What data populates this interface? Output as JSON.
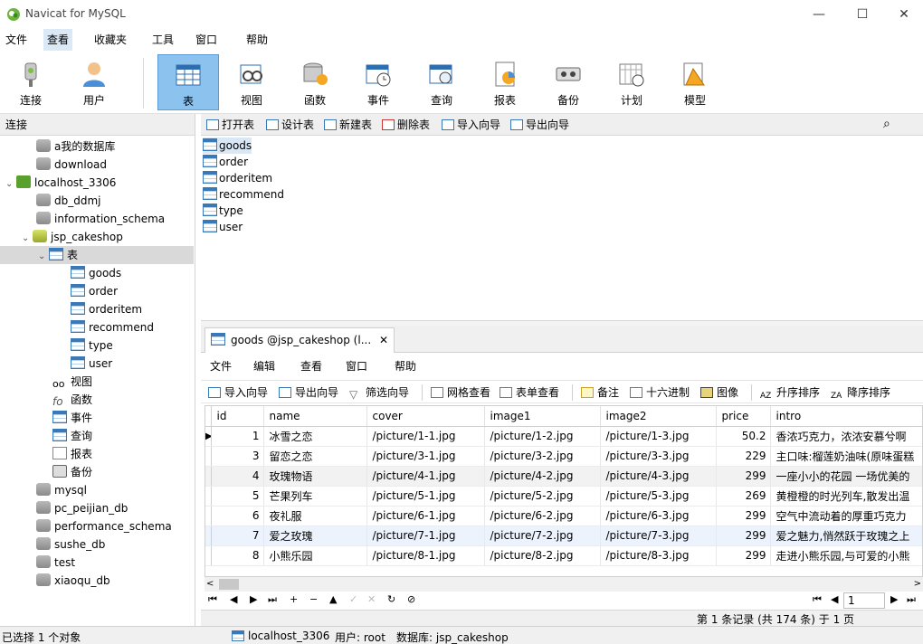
{
  "window": {
    "title": "Navicat for MySQL",
    "controls": {
      "minimize": "—",
      "maximize": "☐",
      "close": "✕"
    }
  },
  "menubar": [
    "文件",
    "查看",
    "收藏夹",
    "工具",
    "窗口",
    "帮助"
  ],
  "toolbar": [
    {
      "label": "连接",
      "icon": "plug-icon"
    },
    {
      "label": "用户",
      "icon": "user-icon"
    },
    {
      "label": "表",
      "icon": "table-icon",
      "active": true
    },
    {
      "label": "视图",
      "icon": "view-icon"
    },
    {
      "label": "函数",
      "icon": "function-icon"
    },
    {
      "label": "事件",
      "icon": "event-icon"
    },
    {
      "label": "查询",
      "icon": "query-icon"
    },
    {
      "label": "报表",
      "icon": "report-icon"
    },
    {
      "label": "备份",
      "icon": "backup-icon"
    },
    {
      "label": "计划",
      "icon": "schedule-icon"
    },
    {
      "label": "模型",
      "icon": "model-icon"
    }
  ],
  "left_panel": {
    "header": "连接",
    "tree": [
      {
        "label": "a我的数据库",
        "type": "db"
      },
      {
        "label": "download",
        "type": "db"
      },
      {
        "label": "localhost_3306",
        "type": "server",
        "expanded": true
      },
      {
        "label": "db_ddmj",
        "type": "db"
      },
      {
        "label": "information_schema",
        "type": "db"
      },
      {
        "label": "jsp_cakeshop",
        "type": "db-open",
        "expanded": true
      },
      {
        "label": "表",
        "type": "folder",
        "expanded": true,
        "selected": true
      },
      {
        "label": "goods",
        "type": "table"
      },
      {
        "label": "order",
        "type": "table"
      },
      {
        "label": "orderitem",
        "type": "table"
      },
      {
        "label": "recommend",
        "type": "table"
      },
      {
        "label": "type",
        "type": "table"
      },
      {
        "label": "user",
        "type": "table"
      },
      {
        "label": "视图",
        "type": "view"
      },
      {
        "label": "函数",
        "type": "function"
      },
      {
        "label": "事件",
        "type": "event"
      },
      {
        "label": "查询",
        "type": "query"
      },
      {
        "label": "报表",
        "type": "report"
      },
      {
        "label": "备份",
        "type": "backup"
      },
      {
        "label": "mysql",
        "type": "db"
      },
      {
        "label": "pc_peijian_db",
        "type": "db"
      },
      {
        "label": "performance_schema",
        "type": "db"
      },
      {
        "label": "sushe_db",
        "type": "db"
      },
      {
        "label": "test",
        "type": "db"
      },
      {
        "label": "xiaoqu_db",
        "type": "db"
      }
    ]
  },
  "object_toolbar": [
    "打开表",
    "设计表",
    "新建表",
    "删除表",
    "导入向导",
    "导出向导"
  ],
  "object_list": [
    "goods",
    "order",
    "orderitem",
    "recommend",
    "type",
    "user"
  ],
  "query_tab": {
    "title": "goods @jsp_cakeshop (l...",
    "close": "✕",
    "menu": [
      "文件",
      "编辑",
      "查看",
      "窗口",
      "帮助"
    ],
    "tools": [
      "导入向导",
      "导出向导",
      "筛选向导",
      "网格查看",
      "表单查看",
      "备注",
      "十六进制",
      "图像",
      "升序排序",
      "降序排序"
    ]
  },
  "grid": {
    "columns": [
      "id",
      "name",
      "cover",
      "image1",
      "image2",
      "price",
      "intro"
    ],
    "rows": [
      [
        "1",
        "冰雪之恋",
        "/picture/1-1.jpg",
        "/picture/1-2.jpg",
        "/picture/1-3.jpg",
        "50.2",
        "香浓巧克力，浓浓安慕兮啊"
      ],
      [
        "3",
        "留恋之恋",
        "/picture/3-1.jpg",
        "/picture/3-2.jpg",
        "/picture/3-3.jpg",
        "229",
        "主口味:榴莲奶油味(原味蛋糕"
      ],
      [
        "4",
        "玫瑰物语",
        "/picture/4-1.jpg",
        "/picture/4-2.jpg",
        "/picture/4-3.jpg",
        "299",
        "一座小小的花园 一场优美的"
      ],
      [
        "5",
        "芒果列车",
        "/picture/5-1.jpg",
        "/picture/5-2.jpg",
        "/picture/5-3.jpg",
        "269",
        "黄橙橙的时光列车,散发出温"
      ],
      [
        "6",
        "夜礼服",
        "/picture/6-1.jpg",
        "/picture/6-2.jpg",
        "/picture/6-3.jpg",
        "299",
        "空气中流动着的厚重巧克力"
      ],
      [
        "7",
        "爱之玫瑰",
        "/picture/7-1.jpg",
        "/picture/7-2.jpg",
        "/picture/7-3.jpg",
        "299",
        "爱之魅力,悄然跃于玫瑰之上"
      ],
      [
        "8",
        "小熊乐园",
        "/picture/8-1.jpg",
        "/picture/8-2.jpg",
        "/picture/8-3.jpg",
        "299",
        "走进小熊乐园,与可爱的小熊"
      ]
    ]
  },
  "navigator": {
    "buttons": [
      "⏮",
      "◀",
      "▶",
      "⏭",
      "+",
      "−",
      "▲",
      "✓",
      "✕",
      "↻",
      "⊘"
    ],
    "page": "1",
    "record_info": "第 1 条记录 (共 174 条) 于 1 页"
  },
  "statusbar": {
    "selection": "已选择 1 个对象",
    "connection": "localhost_3306",
    "user": "用户: root",
    "database": "数据库: jsp_cakeshop"
  },
  "colors": {
    "toolbar_active": "#8cc2ee",
    "selection": "#d9d9d9",
    "panel_header": "#efefef"
  }
}
